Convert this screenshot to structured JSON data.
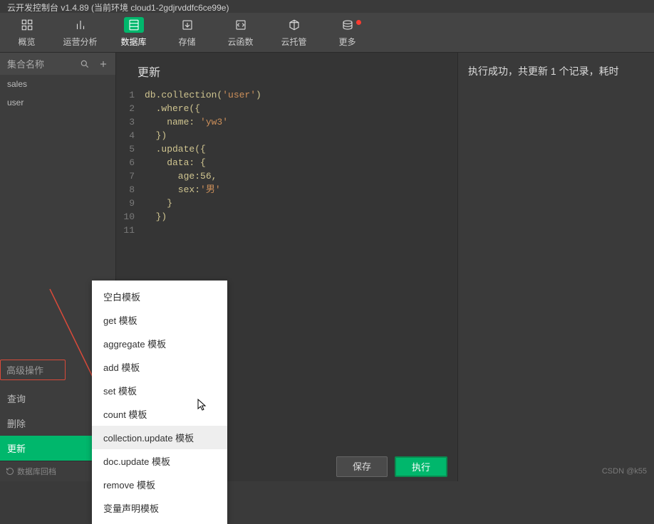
{
  "title": "云开发控制台 v1.4.89  (当前环境 cloud1-2gdjrvddfc6ce99e)",
  "toolbar": {
    "overview": "概览",
    "analytics": "运营分析",
    "database": "数据库",
    "storage": "存储",
    "cloudfn": "云函数",
    "hosting": "云托管",
    "more": "更多"
  },
  "sidebar": {
    "heading": "集合名称",
    "collections": [
      "sales",
      "user"
    ],
    "advanced_heading": "高级操作",
    "advanced_items": [
      "查询",
      "删除",
      "更新"
    ],
    "advanced_selected": 2,
    "footer": "数据库回档"
  },
  "editor": {
    "title": "更新",
    "lines": [
      "db.collection('user')",
      "  .where({",
      "    name: 'yw3'",
      "  })",
      "  .update({",
      "    data: {",
      "      age:56,",
      "      sex:'男'",
      "    }",
      "  })",
      ""
    ]
  },
  "context_menu": {
    "items": [
      "空白模板",
      "get 模板",
      "aggregate 模板",
      "add 模板",
      "set 模板",
      "count 模板",
      "collection.update 模板",
      "doc.update 模板",
      "remove 模板",
      "变量声明模板"
    ],
    "hover_index": 6
  },
  "buttons": {
    "save": "保存",
    "run": "执行"
  },
  "result": "执行成功，共更新 1 个记录，耗时",
  "watermark": "CSDN @k55"
}
